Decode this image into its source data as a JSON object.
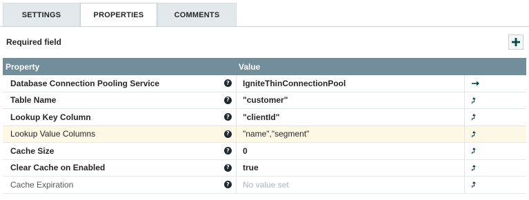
{
  "tabs": [
    {
      "label": "SETTINGS",
      "active": false
    },
    {
      "label": "PROPERTIES",
      "active": true
    },
    {
      "label": "COMMENTS",
      "active": false
    }
  ],
  "required_label": "Required field",
  "table": {
    "headers": {
      "property": "Property",
      "value": "Value"
    },
    "rows": [
      {
        "property": "Database Connection Pooling Service",
        "value": "IgniteThinConnectionPool",
        "action_icon": "go-to-service-arrow-icon"
      },
      {
        "property": "Table Name",
        "value": "\"customer\"",
        "action_icon": "expression-language-icon"
      },
      {
        "property": "Lookup Key Column",
        "value": "\"clientId\"",
        "action_icon": "expression-language-icon"
      },
      {
        "property": "Lookup Value Columns",
        "value": "\"name\",\"segment\"",
        "action_icon": "expression-language-icon"
      },
      {
        "property": "Cache Size",
        "value": "0",
        "action_icon": "expression-language-icon"
      },
      {
        "property": "Clear Cache on Enabled",
        "value": "true",
        "action_icon": "expression-language-icon"
      },
      {
        "property": "Cache Expiration",
        "value": "No value set",
        "action_icon": "expression-language-icon"
      }
    ]
  },
  "colors": {
    "header_bg": "#728e9b",
    "highlight_row": "#fdf8e5",
    "tab_inactive": "#e3e8eb"
  }
}
